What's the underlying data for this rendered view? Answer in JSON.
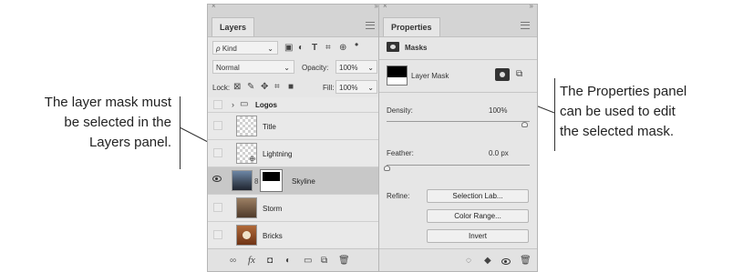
{
  "callouts": {
    "left": [
      "The layer mask must",
      "be selected in the",
      "Layers panel."
    ],
    "right": [
      "The Properties panel",
      "can be used to edit",
      "the selected mask."
    ]
  },
  "layers_panel": {
    "close": "×",
    "collapse": "»",
    "tab": "Layers",
    "filter_kind": "Kind",
    "blend_mode": "Normal",
    "opacity_label": "Opacity:",
    "opacity_value": "100%",
    "lock_label": "Lock:",
    "fill_label": "Fill:",
    "fill_value": "100%",
    "layers": [
      {
        "name": "Logos",
        "type": "group",
        "visible": false
      },
      {
        "name": "Title",
        "type": "text",
        "visible": false
      },
      {
        "name": "Lightning",
        "type": "smart",
        "visible": false
      },
      {
        "name": "Skyline",
        "type": "image-mask",
        "visible": true,
        "selected": true
      },
      {
        "name": "Storm",
        "type": "image",
        "visible": false
      },
      {
        "name": "Bricks",
        "type": "image",
        "visible": false
      }
    ],
    "footer_icons": [
      "link-icon",
      "fx-icon",
      "add-mask-icon",
      "adjustment-icon",
      "folder-icon",
      "new-layer-icon",
      "trash-icon"
    ],
    "fx_label": "fx"
  },
  "properties_panel": {
    "close": "×",
    "collapse": "»",
    "tab": "Properties",
    "section": "Masks",
    "mask_name": "Layer Mask",
    "density_label": "Density:",
    "density_value": "100%",
    "feather_label": "Feather:",
    "feather_value": "0.0 px",
    "refine_label": "Refine:",
    "buttons": [
      "Selection Lab...",
      "Color Range...",
      "Invert"
    ],
    "footer_icons": [
      "load-selection-icon",
      "apply-mask-icon",
      "toggle-mask-icon",
      "delete-mask-icon"
    ]
  },
  "colors": {
    "panel_bg": "#e6e6e6",
    "selected_row": "#c8c8c8"
  }
}
